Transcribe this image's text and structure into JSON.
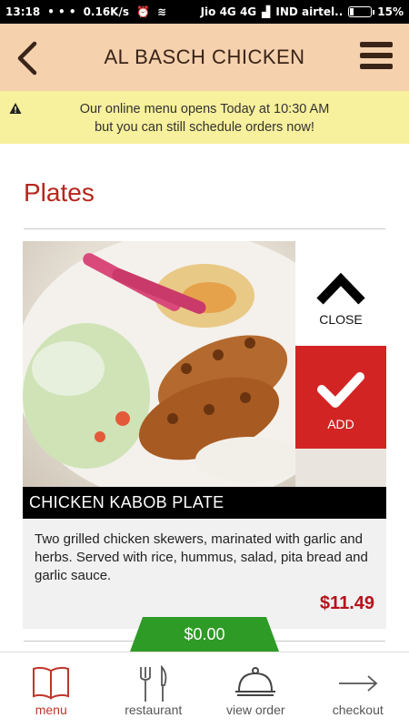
{
  "status_bar": {
    "time": "13:18",
    "indicators": "• • •",
    "speed": "0.16K/s",
    "carrier1": "Jio 4G 4G",
    "carrier2": "IND airtel..",
    "battery_label": "15%",
    "battery_level": 0.15
  },
  "header": {
    "title": "AL BASCH CHICKEN",
    "back_icon": "chevron-left-icon",
    "menu_icon": "hamburger-icon"
  },
  "notice": {
    "line1": "Our online menu opens Today at 10:30 AM",
    "line2": "but you can still schedule orders now!",
    "icon": "warning-icon"
  },
  "section": {
    "title": "Plates"
  },
  "item": {
    "name": "CHICKEN KABOB PLATE",
    "description": "Two grilled chicken skewers, marinated with garlic and herbs. Served with rice, hummus, salad, pita bread and garlic sauce.",
    "price": "$11.49",
    "close_label": "CLOSE",
    "add_label": "ADD"
  },
  "cart": {
    "total": "$0.00"
  },
  "bottom_nav": {
    "items": [
      {
        "label": "menu",
        "icon": "book-icon"
      },
      {
        "label": "restaurant",
        "icon": "fork-knife-icon"
      },
      {
        "label": "view order",
        "icon": "cloche-icon"
      },
      {
        "label": "checkout",
        "icon": "arrow-right-icon"
      }
    ]
  },
  "colors": {
    "header_bg": "#f5d1ad",
    "notice_bg": "#f7f09c",
    "accent_red": "#b5261c",
    "add_red": "#d32424",
    "cart_green": "#2e9b26"
  }
}
